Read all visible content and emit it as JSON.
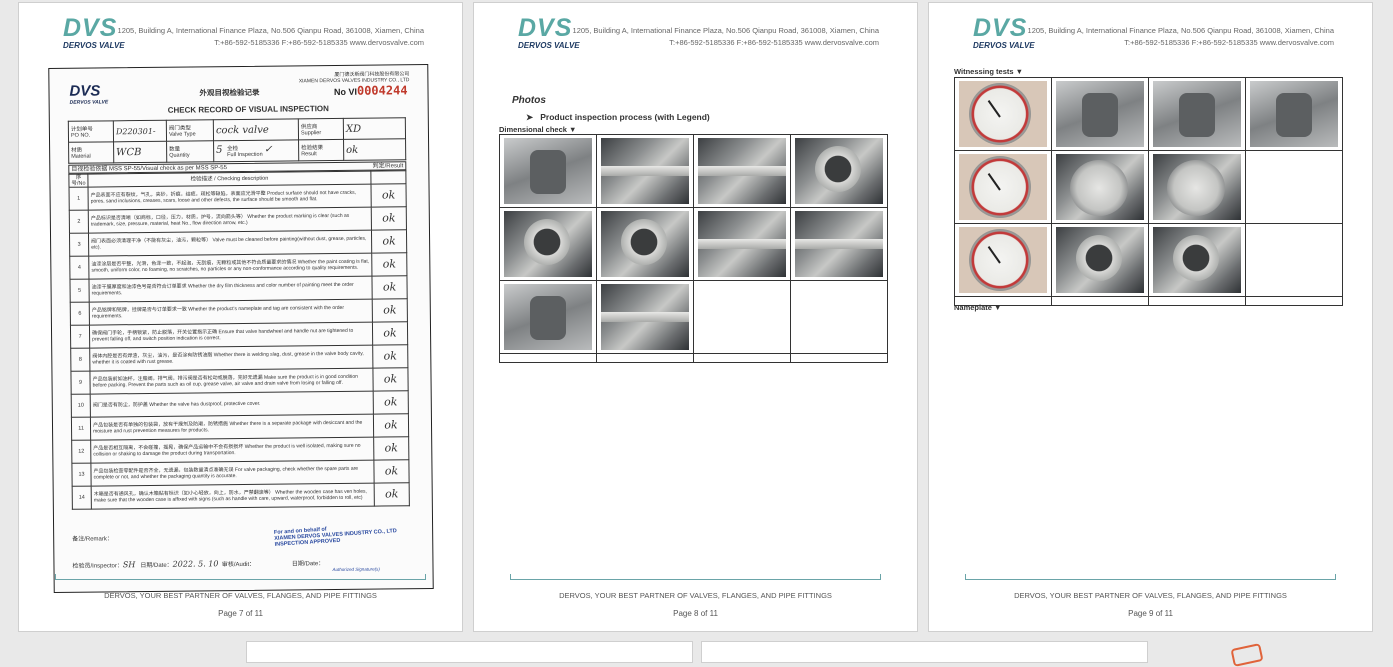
{
  "header": {
    "logo_mark": "DVS",
    "logo_sub": "DERVOS VALVE",
    "address_line1": "1205, Building A, International Finance Plaza, No.506 Qianpu Road, 361008, Xiamen, China",
    "address_line2": "T:+86-592-5185336   F:+86-592-5185335   www.dervosvalve.com"
  },
  "footer": {
    "slogan": "DERVOS, YOUR BEST PARTNER OF VALVES, FLANGES, AND PIPE FITTINGS"
  },
  "pages": [
    {
      "page_label": "Page 7 of 11"
    },
    {
      "page_label": "Page 8 of 11"
    },
    {
      "page_label": "Page 9 of 11"
    }
  ],
  "record": {
    "logo": "DVS",
    "logo_sub": "DERVOS VALVE",
    "title_cn": "外观目视检验记录",
    "title_en": "CHECK RECORD OF VISUAL INSPECTION",
    "company_cn": "厦门德沃斯阀门科技股份有限公司",
    "company_en": "XIAMEN DERVOS VALVES INDUSTRY CO., LTD",
    "no_label": "No VI",
    "no_value": "0004244",
    "po_label": "计划单号\nPO NO.",
    "po_value": "D220301-",
    "valve_type_label": "阀门类型\nValve Type",
    "valve_type_value": "cock valve",
    "supplier_label": "供应商\nSupplier",
    "supplier_value": "XD",
    "material_label": "材质\nMaterial",
    "material_value": "WCB",
    "quantity_label": "数量\nQuantity",
    "quantity_value": "5",
    "full_insp_label": "全检\nFull Inspection",
    "full_insp_value": "✓",
    "result_label": "检验结果\nResult",
    "result_value": "ok",
    "standard": "目视检验依据 MSS SP-55/Visual check as per  MSS SP-55",
    "judge_label": "判定/Result",
    "col_no": "序号/No",
    "col_desc": "检验描述 / Checking description",
    "items": [
      {
        "no": "1",
        "desc": "产品表面不应有裂纹，气孔，夹砂，折痕，结疤，疏松等缺陷，表面应光滑平整 Product surface should not have cracks, pores, sand inclusions, creases, scars, loose and other defects, the surface should be smooth and flat.",
        "result": "ok"
      },
      {
        "no": "2",
        "desc": "产品标识是否清晰（如商标，口径，压力，材质，炉号，流向箭头等） Whether the product marking is clear (such as trademark, size, pressure, material, heat No., flow direction arrow, etc.)",
        "result": "ok"
      },
      {
        "no": "3",
        "desc": "阀门表面必须清理干净（不能有灰尘，油污，颗粒等） Valve must be cleaned before painting(without dust, grease, particles, etc).",
        "result": "ok"
      },
      {
        "no": "4",
        "desc": "油漆涂层是否平整，光滑，色泽一致，不起泡，无刮痕，无颗粒或其他不符合质量要求的情况 Whether the paint coating is flat, smooth, uniform color, no foaming, no scratches, no particles or any non-conformance according to quality requirements.",
        "result": "ok"
      },
      {
        "no": "5",
        "desc": "油漆干膜厚度和油漆色号是否符合订单要求 Whether the dry film thickness and color number of painting meet the order requirements.",
        "result": "ok"
      },
      {
        "no": "6",
        "desc": "产品铭牌和铭牌，挂牌是否与订单要求一致 Whether the product's nameplate and tag are consistent with the order requirements.",
        "result": "ok"
      },
      {
        "no": "7",
        "desc": "确保阀门手轮，手柄锁紧，防止脱落，开关位置指示正确 Ensure that valve handwheel and handle nut are tightened to prevent falling off, and switch position indication is correct.",
        "result": "ok"
      },
      {
        "no": "8",
        "desc": "阀体内腔是否有焊渣，灰尘，油污，是否涂有防锈油脂 Whether there is welding slag, dust, grease in the valve body cavity, whether it is coated with rust grease.",
        "result": "ok"
      },
      {
        "no": "9",
        "desc": "产品包装前如油杯，注脂阀，排气阀，排污阀是否有松动或脱落，完好无遗漏 Make sure the product is in good condition before packing. Prevent the parts such as oil cup, grease valve, air valve and drain valve from losing or falling off.",
        "result": "ok"
      },
      {
        "no": "10",
        "desc": "阀门是否有防尘，防护盖 Whether the valve has dustproof, protective cover.",
        "result": "ok"
      },
      {
        "no": "11",
        "desc": "产品包装是否有单独的包装袋，放有干燥剂及防潮，防锈措施 Whether there is a separate package with desiccant and the moisture and rust prevention measures for products.",
        "result": "ok"
      },
      {
        "no": "12",
        "desc": "产品是否相互隔离，不会碰撞，摇晃，确保产品运输中不会有损损坏 Whether the product is well isolated, making sure no collision or shaking to damage the product during transportation.",
        "result": "ok"
      },
      {
        "no": "13",
        "desc": "产品包装检查零配件是否齐全，无遗漏，包装数量清点准确无误 For valve packaging, check whether the spare parts are complete or not, and whether the packaging quantity is accurate.",
        "result": "ok"
      },
      {
        "no": "14",
        "desc": "木箱是否有通风孔，确认木箱贴有标识（如小心轻放，向上，防水，严禁翻滚等） Whether the wooden case has ven holes, make sure that the wooden case is affixed with signs (such as handle with care, upward, waterproof, forbidden to roll, etc)",
        "result": "ok"
      }
    ],
    "remark_label": "备注/Remark：",
    "stamp_line1": "For and on behalf of",
    "stamp_line2": "XIAMEN DERVOS VALVES INDUSTRY CO., LTD",
    "stamp_line3": "INSPECTION APPROVED",
    "inspector_label": "检验员/Inspector：",
    "inspector_value": "SH",
    "date_label": "日期/Date：",
    "date_value": "2022. 5. 10",
    "audit_label": "审核/Audit：",
    "date2_label": "日期/Date：",
    "authorized": "Authorized Signature(s)"
  },
  "photos_page": {
    "title": "Photos",
    "bullet": "Product inspection process (with Legend)",
    "section": "Dimensional check ▼"
  },
  "tests_page": {
    "section": "Witnessing tests ▼",
    "section2": "Nameplate ▼"
  }
}
